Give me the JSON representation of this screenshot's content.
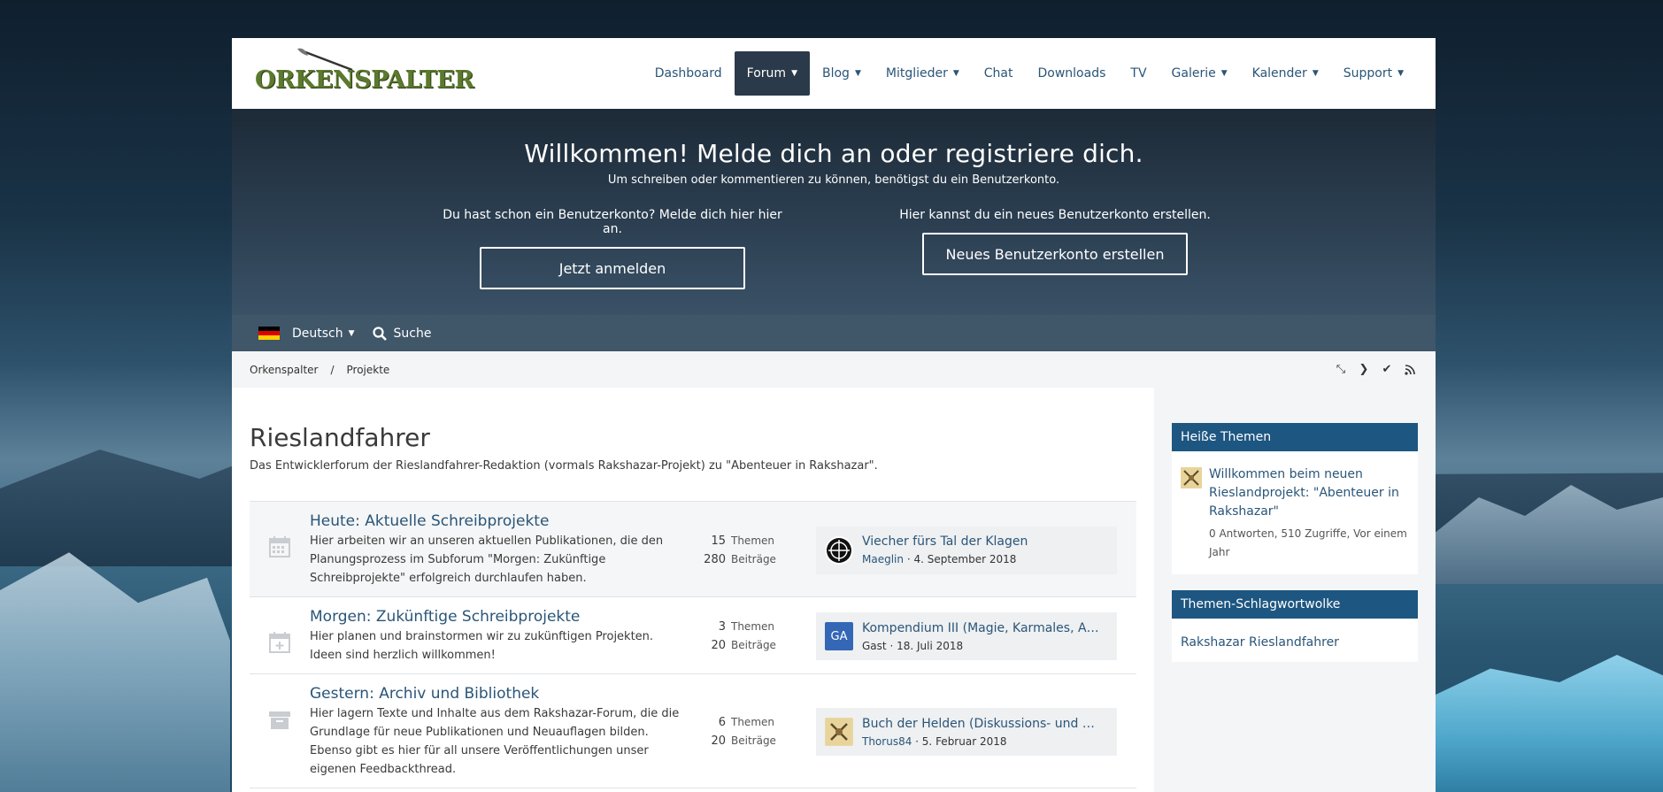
{
  "colors": {
    "accent": "#2a5578",
    "nav_active": "#2b3a4a",
    "box_head": "#1d5681"
  },
  "logo": {
    "text": "ORKENSPALTER"
  },
  "nav": [
    {
      "label": "Dashboard",
      "caret": false,
      "active": false
    },
    {
      "label": "Forum",
      "caret": true,
      "active": true
    },
    {
      "label": "Blog",
      "caret": true,
      "active": false
    },
    {
      "label": "Mitglieder",
      "caret": true,
      "active": false
    },
    {
      "label": "Chat",
      "caret": false,
      "active": false
    },
    {
      "label": "Downloads",
      "caret": false,
      "active": false
    },
    {
      "label": "TV",
      "caret": false,
      "active": false
    },
    {
      "label": "Galerie",
      "caret": true,
      "active": false
    },
    {
      "label": "Kalender",
      "caret": true,
      "active": false
    },
    {
      "label": "Support",
      "caret": true,
      "active": false
    }
  ],
  "hero": {
    "title": "Willkommen! Melde dich an oder registriere dich.",
    "subtitle": "Um schreiben oder kommentieren zu können, benötigst du ein Benutzerkonto.",
    "login_text": "Du hast schon ein Benutzerkonto? Melde dich hier hier an.",
    "login_button": "Jetzt anmelden",
    "register_text": "Hier kannst du ein neues Benutzerkonto erstellen.",
    "register_button": "Neues Benutzerkonto erstellen"
  },
  "langbar": {
    "language": "Deutsch",
    "search": "Suche",
    "flag": "german-flag-icon"
  },
  "breadcrumb": {
    "home": "Orkenspalter",
    "separator": "/",
    "current": "Projekte"
  },
  "page": {
    "title": "Rieslandfahrer",
    "description": "Das Entwicklerforum der Rieslandfahrer-Redaktion (vormals Rakshazar-Projekt) zu \"Abenteuer in Rakshazar\"."
  },
  "boards": [
    {
      "title": "Heute: Aktuelle Schreibprojekte",
      "description": "Hier arbeiten wir an unseren aktuellen Publikationen, die den Planungsprozess im Subforum \"Morgen: Zukünftige Schreibprojekte\" erfolgreich durchlaufen haben.",
      "icon": "calendar-icon",
      "topics": "15",
      "topics_label": "Themen",
      "posts": "280",
      "posts_label": "Beiträge",
      "last_title": "Viecher fürs Tal der Klagen",
      "last_user": "Maeglin",
      "last_date": "· 4. September 2018"
    },
    {
      "title": "Morgen: Zukünftige Schreibprojekte",
      "description": "Hier planen und brainstormen wir zu zukünftigen Projekten. Ideen sind herzlich willkommen!",
      "icon": "calendar-plus-icon",
      "topics": "3",
      "topics_label": "Themen",
      "posts": "20",
      "posts_label": "Beiträge",
      "last_title": "Kompendium III (Magie, Karmales, Alche…",
      "last_user": "Gast",
      "last_user_initials": "GA",
      "last_date": "· 18. Juli 2018"
    },
    {
      "title": "Gestern: Archiv und Bibliothek",
      "description": "Hier lagern Texte und Inhalte aus dem Rakshazar-Forum, die die Grundlage für neue Publikationen und Neuauflagen bilden. Ebenso gibt es hier für all unsere Veröffentlichungen unser eigenen Feedbackthread.",
      "icon": "archive-icon",
      "topics": "6",
      "topics_label": "Themen",
      "posts": "20",
      "posts_label": "Beiträge",
      "last_title": "Buch der Helden (Diskussions- und Feedb…",
      "last_user": "Thorus84",
      "last_date": "· 5. Februar 2018"
    }
  ],
  "sidebar": {
    "hot_title": "Heiße Themen",
    "hot_item_title": "Willkommen beim neuen Rieslandprojekt: \"Abenteuer in Rakshazar\"",
    "hot_item_meta": "0 Antworten, 510 Zugriffe, Vor einem Jahr",
    "tags_title": "Themen-Schlagwortwolke",
    "tags": "Rakshazar Rieslandfahrer"
  }
}
